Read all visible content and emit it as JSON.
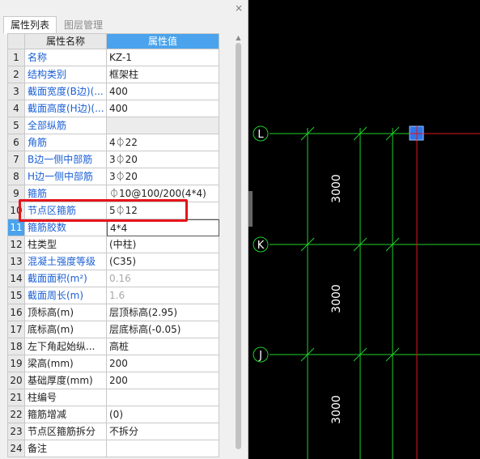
{
  "panel": {
    "close_glyph": "×",
    "tabs": [
      {
        "label": "属性列表",
        "active": true
      },
      {
        "label": "图层管理",
        "active": false
      }
    ],
    "header": {
      "name": "属性名称",
      "value": "属性值"
    },
    "rows": [
      {
        "num": "1",
        "name": "名称",
        "value": "KZ-1",
        "blue": true
      },
      {
        "num": "2",
        "name": "结构类别",
        "value": "框架柱",
        "blue": true
      },
      {
        "num": "3",
        "name": "截面宽度(B边)(...",
        "value": "400",
        "blue": true
      },
      {
        "num": "4",
        "name": "截面高度(H边)(...",
        "value": "400",
        "blue": true
      },
      {
        "num": "5",
        "name": "全部纵筋",
        "value": "",
        "blue": true,
        "group": true
      },
      {
        "num": "6",
        "name": "角筋",
        "value": "4⏀22",
        "blue": true
      },
      {
        "num": "7",
        "name": "B边一侧中部筋",
        "value": "3⏀20",
        "blue": true
      },
      {
        "num": "8",
        "name": "H边一侧中部筋",
        "value": "3⏀20",
        "blue": true
      },
      {
        "num": "9",
        "name": "箍筋",
        "value": "⏀10@100/200(4*4)",
        "blue": true
      },
      {
        "num": "10",
        "name": "节点区箍筋",
        "value": "5⏀12",
        "blue": true
      },
      {
        "num": "11",
        "name": "箍筋胶数",
        "value": "4*4",
        "blue": true,
        "selected": true
      },
      {
        "num": "12",
        "name": "柱类型",
        "value": "(中柱)",
        "blue": false
      },
      {
        "num": "13",
        "name": "混凝土强度等级",
        "value": "(C35)",
        "blue": true
      },
      {
        "num": "14",
        "name": "截面面积(m²)",
        "value": "0.16",
        "blue": true,
        "gray": true
      },
      {
        "num": "15",
        "name": "截面周长(m)",
        "value": "1.6",
        "blue": true,
        "gray": true
      },
      {
        "num": "16",
        "name": "顶标高(m)",
        "value": "层顶标高(2.95)",
        "blue": false
      },
      {
        "num": "17",
        "name": "底标高(m)",
        "value": "层底标高(-0.05)",
        "blue": false
      },
      {
        "num": "18",
        "name": "左下角起始纵...",
        "value": "高桩",
        "blue": false
      },
      {
        "num": "19",
        "name": "梁高(mm)",
        "value": "200",
        "blue": false
      },
      {
        "num": "20",
        "name": "基础厚度(mm)",
        "value": "200",
        "blue": false
      },
      {
        "num": "21",
        "name": "柱编号",
        "value": "",
        "blue": false
      },
      {
        "num": "22",
        "name": "箍筋增减",
        "value": "(0)",
        "blue": false
      },
      {
        "num": "23",
        "name": "节点区箍筋拆分",
        "value": "不拆分",
        "blue": false
      },
      {
        "num": "24",
        "name": "备注",
        "value": "",
        "blue": false
      }
    ]
  },
  "cad": {
    "axes": [
      {
        "label": "L"
      },
      {
        "label": "K"
      },
      {
        "label": "J"
      }
    ],
    "dimensions": [
      "3000",
      "3000",
      "3000"
    ],
    "colors": {
      "grid_line": "#1fcf2a",
      "red_line": "#e0141b",
      "column_fill": "#2f74e8",
      "background": "#000000"
    }
  }
}
